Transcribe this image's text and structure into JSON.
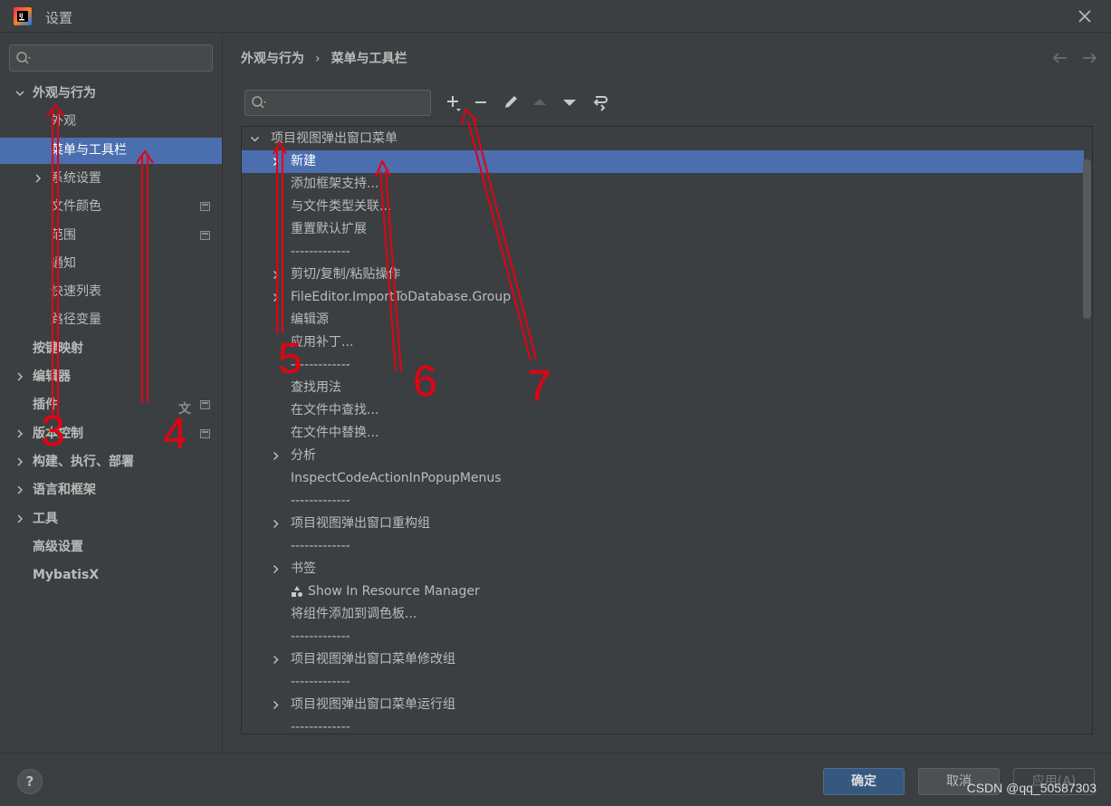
{
  "window": {
    "title": "设置"
  },
  "sidebar": {
    "items": [
      {
        "label": "外观与行为",
        "bold": true,
        "chevron": "down",
        "level": 0
      },
      {
        "label": "外观",
        "level": 1
      },
      {
        "label": "菜单与工具栏",
        "level": 1,
        "selected": true
      },
      {
        "label": "系统设置",
        "level": 1,
        "chevron": "right"
      },
      {
        "label": "文件颜色",
        "level": 1,
        "badge": true
      },
      {
        "label": "范围",
        "level": 1,
        "badge": true
      },
      {
        "label": "通知",
        "level": 1
      },
      {
        "label": "快速列表",
        "level": 1
      },
      {
        "label": "路径变量",
        "level": 1
      },
      {
        "label": "按键映射",
        "bold": true,
        "level": 0
      },
      {
        "label": "编辑器",
        "bold": true,
        "chevron": "right",
        "level": 0
      },
      {
        "label": "插件",
        "bold": true,
        "level": 0,
        "badge": true,
        "translate_icon": true
      },
      {
        "label": "版本控制",
        "bold": true,
        "chevron": "right",
        "level": 0,
        "badge": true
      },
      {
        "label": "构建、执行、部署",
        "bold": true,
        "chevron": "right",
        "level": 0
      },
      {
        "label": "语言和框架",
        "bold": true,
        "chevron": "right",
        "level": 0
      },
      {
        "label": "工具",
        "bold": true,
        "chevron": "right",
        "level": 0
      },
      {
        "label": "高级设置",
        "bold": true,
        "level": 0
      },
      {
        "label": "MybatisX",
        "bold": true,
        "level": 0
      }
    ]
  },
  "breadcrumb": {
    "parent": "外观与行为",
    "separator": "›",
    "current": "菜单与工具栏"
  },
  "toolbar": {
    "icons": [
      "add-icon",
      "remove-icon",
      "edit-icon",
      "move-up-icon",
      "move-down-icon",
      "restore-icon"
    ]
  },
  "menu_tree": {
    "rows": [
      {
        "label": "项目视图弹出窗口菜单",
        "level": 0,
        "chevron": "down"
      },
      {
        "label": "新建",
        "level": 1,
        "chevron": "right",
        "selected": true
      },
      {
        "label": "添加框架支持...",
        "level": 1
      },
      {
        "label": "与文件类型关联...",
        "level": 1
      },
      {
        "label": "重置默认扩展",
        "level": 1
      },
      {
        "label": "-------------",
        "level": 1
      },
      {
        "label": "剪切/复制/粘贴操作",
        "level": 1,
        "chevron": "right"
      },
      {
        "label": "FileEditor.ImportToDatabase.Group",
        "level": 1,
        "chevron": "right"
      },
      {
        "label": "编辑源",
        "level": 1
      },
      {
        "label": "应用补丁...",
        "level": 1
      },
      {
        "label": "-------------",
        "level": 1
      },
      {
        "label": "查找用法",
        "level": 1
      },
      {
        "label": "在文件中查找...",
        "level": 1
      },
      {
        "label": "在文件中替换...",
        "level": 1
      },
      {
        "label": "分析",
        "level": 1,
        "chevron": "right"
      },
      {
        "label": "InspectCodeActionInPopupMenus",
        "level": 1
      },
      {
        "label": "-------------",
        "level": 1
      },
      {
        "label": "项目视图弹出窗口重构组",
        "level": 1,
        "chevron": "right"
      },
      {
        "label": "-------------",
        "level": 1
      },
      {
        "label": "书签",
        "level": 1,
        "chevron": "right"
      },
      {
        "label": "Show In Resource Manager",
        "level": 1,
        "icon": "shapes-icon"
      },
      {
        "label": "将组件添加到调色板...",
        "level": 1
      },
      {
        "label": "-------------",
        "level": 1
      },
      {
        "label": "项目视图弹出窗口菜单修改组",
        "level": 1,
        "chevron": "right"
      },
      {
        "label": "-------------",
        "level": 1
      },
      {
        "label": "项目视图弹出窗口菜单运行组",
        "level": 1,
        "chevron": "right"
      },
      {
        "label": "-------------",
        "level": 1
      }
    ]
  },
  "footer": {
    "help_label": "?",
    "ok_label": "确定",
    "cancel_label": "取消",
    "apply_label": "应用(A)",
    "watermark": "CSDN @qq_50587303"
  },
  "annotations": {
    "color": "#e60012",
    "numbers": [
      "3",
      "4",
      "5",
      "6",
      "7"
    ]
  }
}
